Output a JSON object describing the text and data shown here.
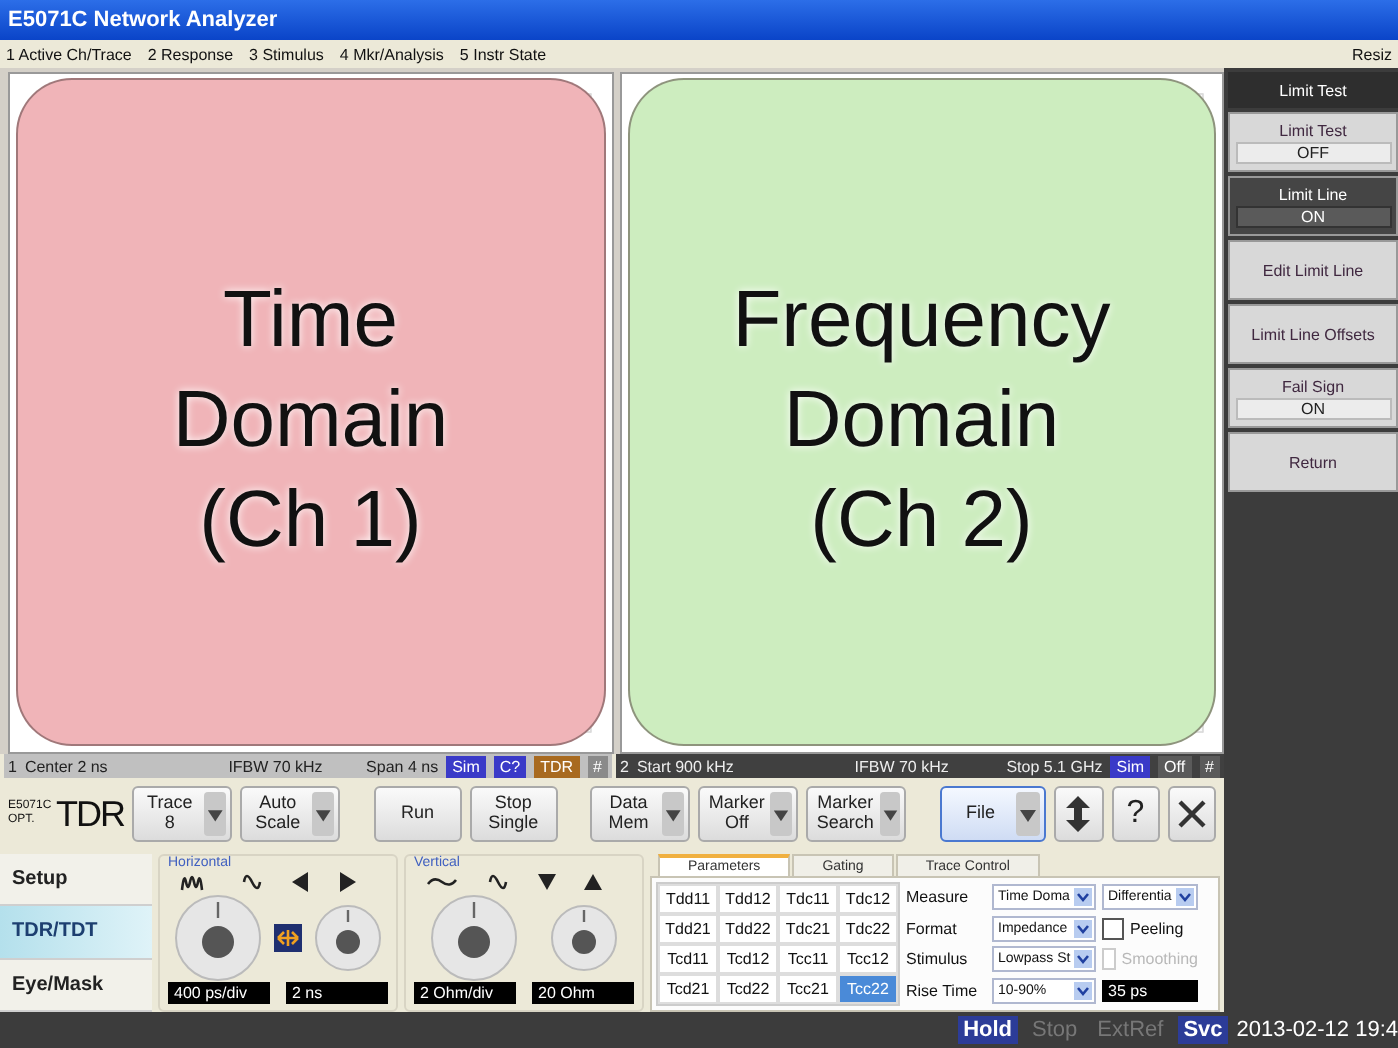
{
  "window": {
    "title": "E5071C Network Analyzer"
  },
  "menu": {
    "items": [
      "1 Active Ch/Trace",
      "2 Response",
      "3 Stimulus",
      "4 Mkr/Analysis",
      "5 Instr State"
    ],
    "right_text": "Resiz"
  },
  "overlays": [
    {
      "text": "Time Domain (Ch 1)",
      "color": "#f0b4b8"
    },
    {
      "text": "Frequency Domain (Ch 2)",
      "color": "#cdedbf"
    }
  ],
  "channel_bars": [
    {
      "number": "1",
      "left": "Center 2 ns",
      "middle": "IFBW 70 kHz",
      "right": "Span 4 ns",
      "badges": [
        {
          "text": "Sim",
          "color": "#3a3ac8"
        },
        {
          "text": "C?",
          "color": "#3a3ac8"
        },
        {
          "text": "TDR",
          "color": "#a86a20"
        },
        {
          "text": "#",
          "color": "#8a8a8a"
        }
      ]
    },
    {
      "number": "2",
      "left": "Start 900 kHz",
      "middle": "IFBW 70 kHz",
      "right": "Stop 5.1 GHz",
      "badges": [
        {
          "text": "Sim",
          "color": "#3a3ac8"
        },
        {
          "text": "Off",
          "color": "#5a5a5a"
        },
        {
          "text": "#",
          "color": "#5a5a5a"
        }
      ]
    }
  ],
  "softkeys": {
    "title": "Limit Test",
    "keys": [
      {
        "kind": "toggle",
        "label": "Limit Test",
        "value": "OFF",
        "selected": false
      },
      {
        "kind": "toggle",
        "label": "Limit Line",
        "value": "ON",
        "selected": true
      },
      {
        "kind": "action",
        "label": "Edit Limit Line",
        "selected": false
      },
      {
        "kind": "action",
        "label": "Limit Line Offsets",
        "selected": false
      },
      {
        "kind": "toggle",
        "label": "Fail Sign",
        "value": "ON",
        "selected": false
      },
      {
        "kind": "action",
        "label": "Return",
        "selected": false
      }
    ]
  },
  "toolbar": {
    "logo_small": "E5071C OPT.",
    "logo": "TDR",
    "buttons": [
      {
        "kind": "dropdown",
        "label": "Trace 8",
        "focused": false
      },
      {
        "kind": "dropdown",
        "label": "Auto Scale",
        "focused": false
      },
      {
        "kind": "plain",
        "label": "Run",
        "focused": false
      },
      {
        "kind": "plain",
        "label": "Stop Single",
        "focused": false
      },
      {
        "kind": "dropdown",
        "label": "Data Mem",
        "focused": false
      },
      {
        "kind": "dropdown",
        "label": "Marker Off",
        "focused": false
      },
      {
        "kind": "dropdown",
        "label": "Marker Search",
        "focused": false
      },
      {
        "kind": "dropdown",
        "label": "File",
        "focused": true
      },
      {
        "kind": "updown",
        "focused": false
      },
      {
        "kind": "text",
        "label": "?",
        "focused": false
      },
      {
        "kind": "close",
        "focused": false
      }
    ]
  },
  "side_tabs": [
    {
      "label": "Setup",
      "selected": false
    },
    {
      "label": "TDR/TDT",
      "selected": true
    },
    {
      "label": "Eye/Mask",
      "selected": false
    }
  ],
  "knob_groups": [
    {
      "title": "Horizontal",
      "readouts": [
        "400 ps/div",
        "2 ns"
      ]
    },
    {
      "title": "Vertical",
      "readouts": [
        "2 Ohm/div",
        "20 Ohm"
      ]
    }
  ],
  "param_tabs": [
    {
      "label": "Parameters",
      "selected": true
    },
    {
      "label": "Gating",
      "selected": false
    },
    {
      "label": "Trace Control",
      "selected": false
    }
  ],
  "param_grid": [
    [
      {
        "label": "Tdd11",
        "selected": false
      },
      {
        "label": "Tdd12",
        "selected": false
      },
      {
        "label": "Tdc11",
        "selected": false
      },
      {
        "label": "Tdc12",
        "selected": false
      }
    ],
    [
      {
        "label": "Tdd21",
        "selected": false
      },
      {
        "label": "Tdd22",
        "selected": false
      },
      {
        "label": "Tdc21",
        "selected": false
      },
      {
        "label": "Tdc22",
        "selected": false
      }
    ],
    [
      {
        "label": "Tcd11",
        "selected": false
      },
      {
        "label": "Tcd12",
        "selected": false
      },
      {
        "label": "Tcc11",
        "selected": false
      },
      {
        "label": "Tcc12",
        "selected": false
      }
    ],
    [
      {
        "label": "Tcd21",
        "selected": false
      },
      {
        "label": "Tcd22",
        "selected": false
      },
      {
        "label": "Tcc21",
        "selected": false
      },
      {
        "label": "Tcc22",
        "selected": true
      }
    ]
  ],
  "settings": [
    {
      "label": "Measure",
      "controls": [
        {
          "kind": "select",
          "value": "Time Doma"
        },
        {
          "kind": "select",
          "value": "Differentia"
        }
      ]
    },
    {
      "label": "Format",
      "controls": [
        {
          "kind": "select",
          "value": "Impedance"
        },
        {
          "kind": "checkbox",
          "label": "Peeling",
          "checked": false,
          "disabled": false
        }
      ]
    },
    {
      "label": "Stimulus",
      "controls": [
        {
          "kind": "select",
          "value": "Lowpass St"
        },
        {
          "kind": "checkbox",
          "label": "Smoothing",
          "checked": false,
          "disabled": true
        }
      ]
    },
    {
      "label": "Rise Time",
      "controls": [
        {
          "kind": "select",
          "value": "10-90%"
        },
        {
          "kind": "readout",
          "value": "35 ps"
        }
      ]
    }
  ],
  "status_bar": {
    "indicators": [
      {
        "label": "Hold",
        "on": true
      },
      {
        "label": "Stop",
        "on": false
      },
      {
        "label": "ExtRef",
        "on": false
      },
      {
        "label": "Svc",
        "on": true
      }
    ],
    "datetime": "2013-02-12 19:4"
  }
}
